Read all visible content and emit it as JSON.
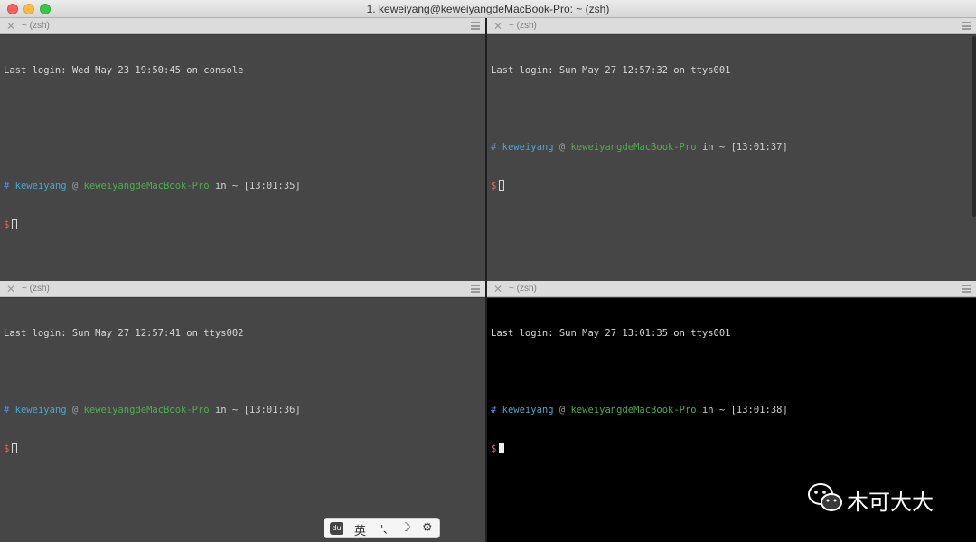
{
  "window": {
    "title": "1. keweiyang@keweiyangdeMacBook-Pro: ~ (zsh)"
  },
  "panes": [
    {
      "label": "~ (zsh)",
      "last_login": "Last login: Wed May 23 19:50:45 on console",
      "prompt": {
        "hash": "#",
        "user": "keweiyang",
        "at": "@",
        "host": "keweiyangdeMacBook-Pro",
        "in": "in ~",
        "time": "[13:01:35]",
        "dollar": "$"
      }
    },
    {
      "label": "~ (zsh)",
      "last_login": "Last login: Sun May 27 12:57:32 on ttys001",
      "prompt": {
        "hash": "#",
        "user": "keweiyang",
        "at": "@",
        "host": "keweiyangdeMacBook-Pro",
        "in": "in ~",
        "time": "[13:01:37]",
        "dollar": "$"
      }
    },
    {
      "label": "~ (zsh)",
      "last_login": "Last login: Sun May 27 12:57:41 on ttys002",
      "prompt": {
        "hash": "#",
        "user": "keweiyang",
        "at": "@",
        "host": "keweiyangdeMacBook-Pro",
        "in": "in ~",
        "time": "[13:01:36]",
        "dollar": "$"
      }
    },
    {
      "label": "~ (zsh)",
      "last_login": "Last login: Sun May 27 13:01:35 on ttys001",
      "prompt": {
        "hash": "#",
        "user": "keweiyang",
        "at": "@",
        "host": "keweiyangdeMacBook-Pro",
        "in": "in ~",
        "time": "[13:01:38]",
        "dollar": "$"
      }
    }
  ],
  "ime_toolbar": {
    "logo": "du",
    "language": "英",
    "punct": "'､",
    "moon": "☽",
    "gear": "⚙"
  },
  "watermark": {
    "text": "木可大大"
  },
  "colors": {
    "pane_bg": "#464646",
    "active_pane_bg": "#000000",
    "user": "#4aa6c9",
    "host": "#4cae4c",
    "dollar": "#e5655c"
  }
}
